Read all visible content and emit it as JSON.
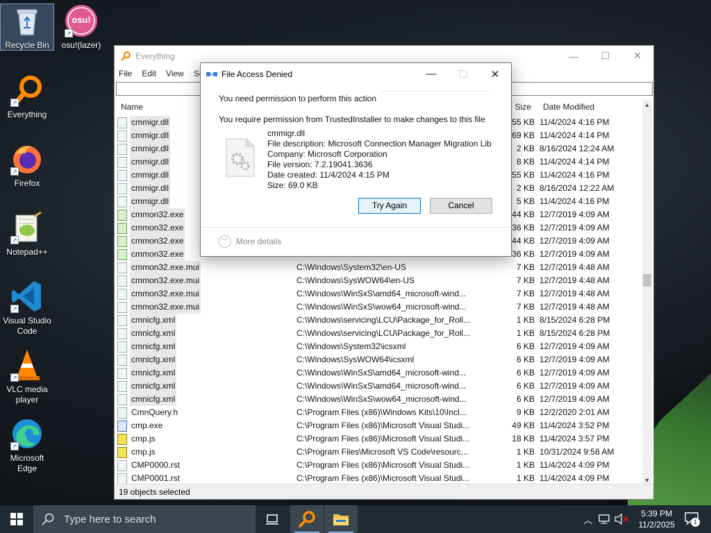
{
  "desktop": {
    "icons": [
      {
        "label": "Recycle Bin"
      },
      {
        "label": "osu!(lazer)",
        "badge": "osu!"
      },
      {
        "label": "Everything"
      },
      {
        "label": "Firefox"
      },
      {
        "label": "Notepad++"
      },
      {
        "label": "Visual Studio Code"
      },
      {
        "label": "VLC media player"
      },
      {
        "label": "Microsoft Edge"
      }
    ]
  },
  "everything": {
    "title": "Everything",
    "menu": [
      "File",
      "Edit",
      "View",
      "Se"
    ],
    "search_value": "",
    "columns": {
      "name": "Name",
      "size": "Size",
      "date": "Date Modified"
    },
    "rows": [
      {
        "name": "cmmigr.dll",
        "path": "",
        "size": "55 KB",
        "date": "11/4/2024 4:16 PM",
        "icon": "dll"
      },
      {
        "name": "cmmigr.dll",
        "path": "",
        "size": "69 KB",
        "date": "11/4/2024 4:14 PM",
        "icon": "dll"
      },
      {
        "name": "cmmigr.dll",
        "path": "",
        "size": "2 KB",
        "date": "8/16/2024 12:24 AM",
        "icon": "dll"
      },
      {
        "name": "cmmigr.dll",
        "path": "",
        "size": "8 KB",
        "date": "11/4/2024 4:14 PM",
        "icon": "dll"
      },
      {
        "name": "cmmigr.dll",
        "path": "",
        "size": "55 KB",
        "date": "11/4/2024 4:16 PM",
        "icon": "dll"
      },
      {
        "name": "cmmigr.dll",
        "path": "",
        "size": "2 KB",
        "date": "8/16/2024 12:22 AM",
        "icon": "dll"
      },
      {
        "name": "cmmigr.dll",
        "path": "",
        "size": "5 KB",
        "date": "11/4/2024 4:16 PM",
        "icon": "dll"
      },
      {
        "name": "cmmon32.exe",
        "path": "",
        "size": "44 KB",
        "date": "12/7/2019 4:09 AM",
        "icon": "exe"
      },
      {
        "name": "cmmon32.exe",
        "path": "",
        "size": "36 KB",
        "date": "12/7/2019 4:09 AM",
        "icon": "exe"
      },
      {
        "name": "cmmon32.exe",
        "path": "",
        "size": "44 KB",
        "date": "12/7/2019 4:09 AM",
        "icon": "exe"
      },
      {
        "name": "cmmon32.exe",
        "path": "",
        "size": "36 KB",
        "date": "12/7/2019 4:09 AM",
        "icon": "exe"
      },
      {
        "name": "cmmon32.exe.mui",
        "path": "C:\\Windows\\System32\\en-US",
        "size": "7 KB",
        "date": "12/7/2019 4:48 AM",
        "icon": "doc"
      },
      {
        "name": "cmmon32.exe.mui",
        "path": "C:\\Windows\\SysWOW64\\en-US",
        "size": "7 KB",
        "date": "12/7/2019 4:48 AM",
        "icon": "doc"
      },
      {
        "name": "cmmon32.exe.mui",
        "path": "C:\\Windows\\WinSxS\\amd64_microsoft-wind...",
        "size": "7 KB",
        "date": "12/7/2019 4:48 AM",
        "icon": "doc"
      },
      {
        "name": "cmmon32.exe.mui",
        "path": "C:\\Windows\\WinSxS\\wow64_microsoft-wind...",
        "size": "7 KB",
        "date": "12/7/2019 4:48 AM",
        "icon": "doc"
      },
      {
        "name": "cmnicfg.xml",
        "path": "C:\\Windows\\servicing\\LCU\\Package_for_Roll...",
        "size": "1 KB",
        "date": "8/15/2024 6:28 PM",
        "icon": "dll"
      },
      {
        "name": "cmnicfg.xml",
        "path": "C:\\Windows\\servicing\\LCU\\Package_for_Roll...",
        "size": "1 KB",
        "date": "8/15/2024 6:28 PM",
        "icon": "dll"
      },
      {
        "name": "cmnicfg.xml",
        "path": "C:\\Windows\\System32\\icsxml",
        "size": "6 KB",
        "date": "12/7/2019 4:09 AM",
        "icon": "dll"
      },
      {
        "name": "cmnicfg.xml",
        "path": "C:\\Windows\\SysWOW64\\icsxml",
        "size": "6 KB",
        "date": "12/7/2019 4:09 AM",
        "icon": "dll"
      },
      {
        "name": "cmnicfg.xml",
        "path": "C:\\Windows\\WinSxS\\amd64_microsoft-wind...",
        "size": "6 KB",
        "date": "12/7/2019 4:09 AM",
        "icon": "dll"
      },
      {
        "name": "cmnicfg.xml",
        "path": "C:\\Windows\\WinSxS\\amd64_microsoft-wind...",
        "size": "6 KB",
        "date": "12/7/2019 4:09 AM",
        "icon": "dll"
      },
      {
        "name": "cmnicfg.xml",
        "path": "C:\\Windows\\WinSxS\\wow64_microsoft-wind...",
        "size": "6 KB",
        "date": "12/7/2019 4:09 AM",
        "icon": "dll"
      },
      {
        "name": "CmnQuery.h",
        "path": "C:\\Program Files (x86)\\Windows Kits\\10\\Incl...",
        "size": "9 KB",
        "date": "12/2/2020 2:01 AM",
        "icon": "doc"
      },
      {
        "name": "cmp.exe",
        "path": "C:\\Program Files (x86)\\Microsoft Visual Studi...",
        "size": "49 KB",
        "date": "11/4/2024 3:52 PM",
        "icon": "exe2"
      },
      {
        "name": "cmp.js",
        "path": "C:\\Program Files (x86)\\Microsoft Visual Studi...",
        "size": "18 KB",
        "date": "11/4/2024 3:57 PM",
        "icon": "js"
      },
      {
        "name": "cmp.js",
        "path": "C:\\Program Files\\Microsoft VS Code\\resourc...",
        "size": "1 KB",
        "date": "10/31/2024 9:58 AM",
        "icon": "js"
      },
      {
        "name": "CMP0000.rst",
        "path": "C:\\Program Files (x86)\\Microsoft Visual Studi...",
        "size": "1 KB",
        "date": "11/4/2024 4:09 PM",
        "icon": "doc"
      },
      {
        "name": "CMP0001.rst",
        "path": "C:\\Program Files (x86)\\Microsoft Visual Studi...",
        "size": "1 KB",
        "date": "11/4/2024 4:09 PM",
        "icon": "doc"
      }
    ],
    "status": "19 objects selected"
  },
  "dialog": {
    "title": "File Access Denied",
    "heading": "You need permission to perform this action",
    "message": "You require permission from TrustedInstaller to make changes to this file",
    "file_name": "cmmigr.dll",
    "file_description": "File description: Microsoft Connection Manager Migration Lib",
    "company": "Company: Microsoft Corporation",
    "file_version": "File version: 7.2.19041.3636",
    "date_created": "Date created: 11/4/2024 4:15 PM",
    "size": "Size: 69.0 KB",
    "try_again": "Try Again",
    "cancel": "Cancel",
    "more_details": "More details"
  },
  "taskbar": {
    "search_placeholder": "Type here to search",
    "time": "5:39 PM",
    "date": "11/2/2025",
    "notification_count": "1"
  },
  "colors": {
    "accent": "#0078d7",
    "taskbar": "#1f2a33",
    "selection": "#e8e8e8"
  }
}
